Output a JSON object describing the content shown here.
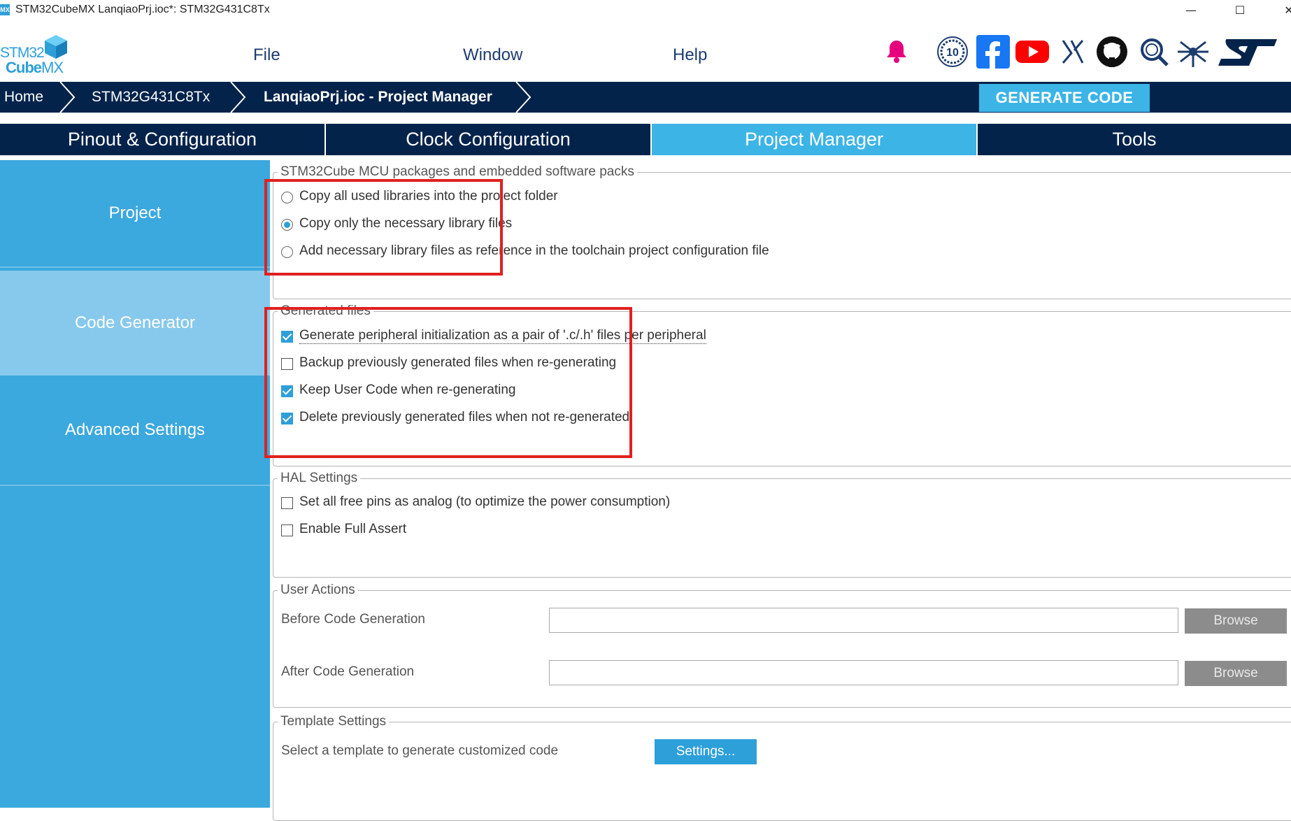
{
  "window": {
    "app_icon_text": "MX",
    "title": "STM32CubeMX LanqiaoPrj.ioc*: STM32G431C8Tx",
    "minimize": "—",
    "maximize": "☐",
    "close": "✕"
  },
  "logo": {
    "line1": "STM32",
    "line2_a": "Cube",
    "line2_b": "MX"
  },
  "menu": [
    "File",
    "Window",
    "Help"
  ],
  "toolbar_icons": [
    "bell-icon",
    "anniversary-10-badge-icon",
    "facebook-icon",
    "youtube-icon",
    "x-icon",
    "github-icon",
    "search-icon",
    "network-icon",
    "st-logo-icon"
  ],
  "breadcrumb": [
    "Home",
    "STM32G431C8Tx",
    "LanqiaoPrj.ioc - Project Manager"
  ],
  "generate_button": "GENERATE CODE",
  "tabs": [
    {
      "label": "Pinout & Configuration",
      "active": false
    },
    {
      "label": "Clock Configuration",
      "active": false
    },
    {
      "label": "Project Manager",
      "active": true
    },
    {
      "label": "Tools",
      "active": false
    }
  ],
  "sidebar": [
    {
      "label": "Project",
      "active": false
    },
    {
      "label": "Code Generator",
      "active": true
    },
    {
      "label": "Advanced Settings",
      "active": false
    }
  ],
  "packages": {
    "legend": "STM32Cube MCU packages and embedded software packs",
    "options": [
      {
        "label": "Copy all used libraries into the project folder",
        "selected": false
      },
      {
        "label": "Copy only the necessary library files",
        "selected": true
      },
      {
        "label": "Add necessary library files as reference in the toolchain project configuration file",
        "selected": false
      }
    ]
  },
  "generated_files": {
    "legend": "Generated files",
    "options": [
      {
        "label": "Generate peripheral initialization as a pair of '.c/.h' files per peripheral",
        "checked": true
      },
      {
        "label": "Backup previously generated files when re-generating",
        "checked": false
      },
      {
        "label": "Keep User Code when re-generating",
        "checked": true
      },
      {
        "label": "Delete previously generated files when not re-generated",
        "checked": true
      }
    ]
  },
  "hal_settings": {
    "legend": "HAL Settings",
    "options": [
      {
        "label": "Set all free pins as analog (to optimize the power consumption)",
        "checked": false
      },
      {
        "label": "Enable Full Assert",
        "checked": false
      }
    ]
  },
  "user_actions": {
    "legend": "User Actions",
    "before_label": "Before Code Generation",
    "before_value": "",
    "after_label": "After Code Generation",
    "after_value": "",
    "browse_label": "Browse"
  },
  "template_settings": {
    "legend": "Template Settings",
    "label": "Select a template to generate customized code",
    "button": "Settings..."
  },
  "colors": {
    "accent": "#3cb4e6",
    "navy": "#03234b",
    "highlight_box": "#e02020",
    "sidebar": "#3ba8de",
    "sidebar_active": "#87c9ec"
  }
}
